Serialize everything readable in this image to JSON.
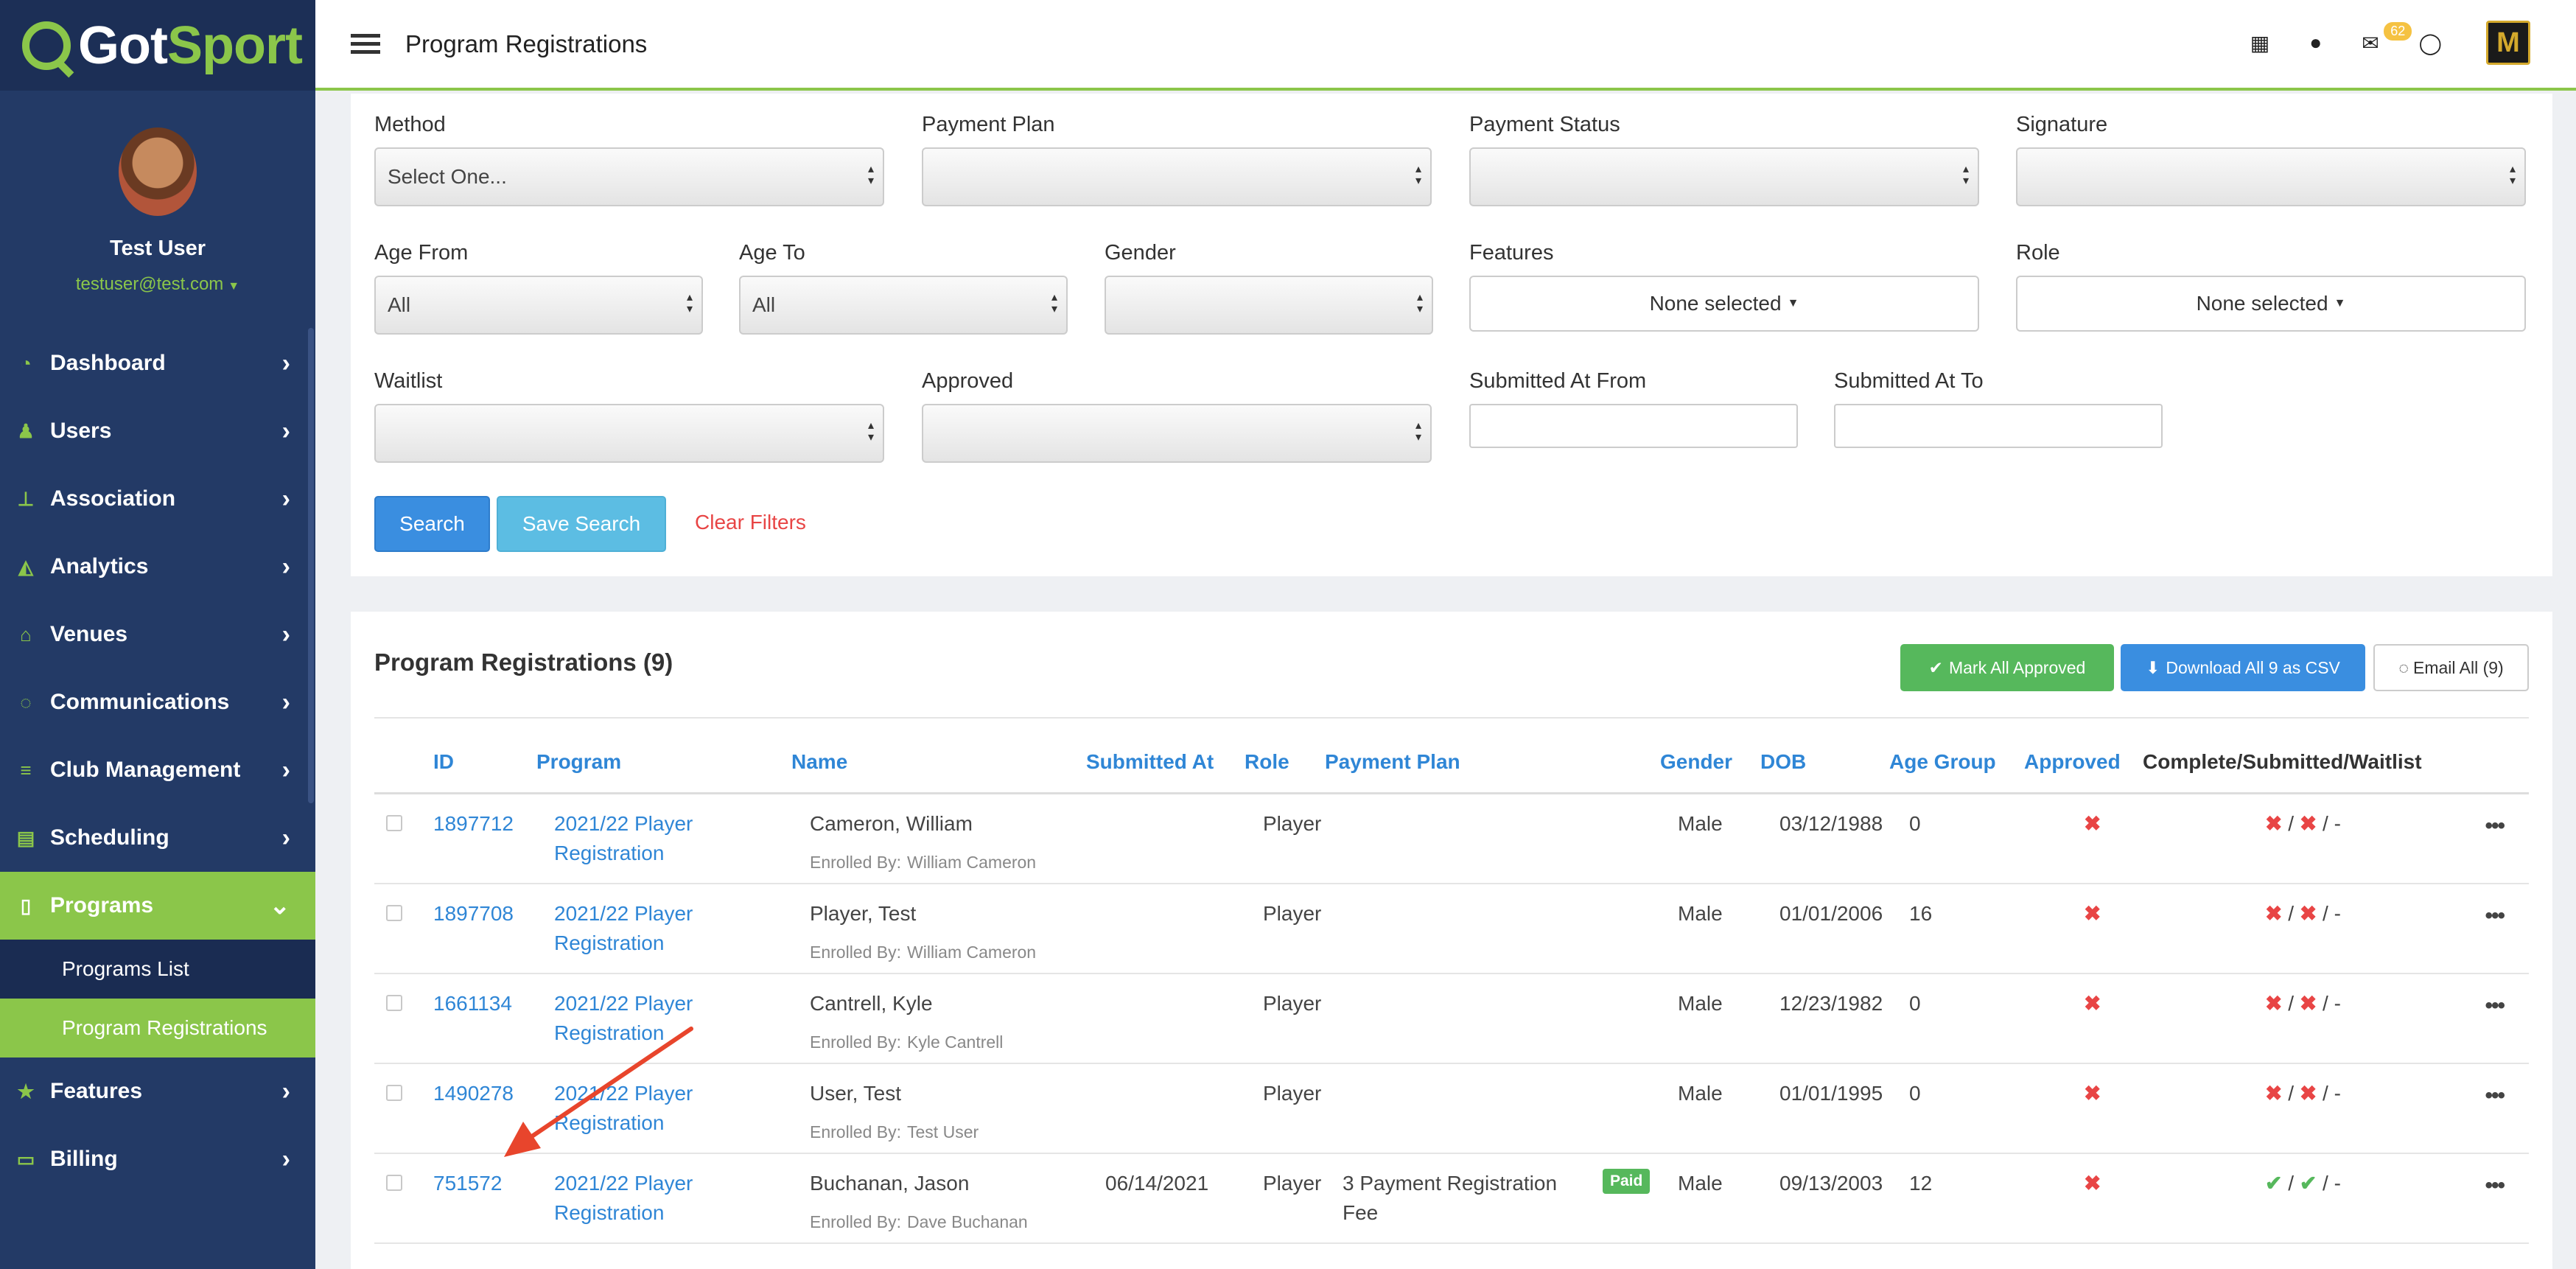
{
  "sidebar": {
    "brand_got": "Got",
    "brand_sport": "Sport",
    "user_name": "Test User",
    "user_email": "testuser@test.com",
    "items": [
      {
        "label": "Dashboard",
        "icon": "dashboard-icon"
      },
      {
        "label": "Users",
        "icon": "users-icon"
      },
      {
        "label": "Association",
        "icon": "sitemap-icon"
      },
      {
        "label": "Analytics",
        "icon": "chart-icon"
      },
      {
        "label": "Venues",
        "icon": "home-icon"
      },
      {
        "label": "Communications",
        "icon": "chat-icon"
      },
      {
        "label": "Club Management",
        "icon": "list-icon"
      },
      {
        "label": "Scheduling",
        "icon": "calendar-icon"
      },
      {
        "label": "Programs",
        "icon": "file-icon"
      },
      {
        "label": "Features",
        "icon": "star-icon"
      },
      {
        "label": "Billing",
        "icon": "credit-card-icon"
      }
    ],
    "sub_items": [
      "Programs List",
      "Program Registrations"
    ]
  },
  "header": {
    "title": "Program Registrations",
    "message_count": "62",
    "org_logo_letter": "M"
  },
  "filters": {
    "method_label": "Method",
    "method_value": "Select One...",
    "payment_plan_label": "Payment Plan",
    "payment_status_label": "Payment Status",
    "signature_label": "Signature",
    "age_from_label": "Age From",
    "age_from_value": "All",
    "age_to_label": "Age To",
    "age_to_value": "All",
    "gender_label": "Gender",
    "features_label": "Features",
    "features_value": "None selected",
    "role_label": "Role",
    "role_value": "None selected",
    "waitlist_label": "Waitlist",
    "approved_label": "Approved",
    "submitted_from_label": "Submitted At From",
    "submitted_to_label": "Submitted At To",
    "search_btn": "Search",
    "save_search_btn": "Save Search",
    "clear_filters": "Clear Filters"
  },
  "results": {
    "title": "Program Registrations (9)",
    "mark_all_approved": "Mark All Approved",
    "download_csv": "Download All 9 as CSV",
    "email_all": "Email All (9)",
    "columns": [
      "ID",
      "Program",
      "Name",
      "Submitted At",
      "Role",
      "Payment Plan",
      "Gender",
      "DOB",
      "Age Group",
      "Approved",
      "Complete/Submitted/Waitlist"
    ],
    "enrolled_prefix": "Enrolled By:",
    "rows": [
      {
        "id": "1897712",
        "program1": "2021/22 Player",
        "program2": "Registration",
        "name": "Cameron, William",
        "enrolled_by": "William Cameron",
        "submitted": "",
        "role": "Player",
        "plan1": "",
        "plan2": "",
        "status": "",
        "gender": "Male",
        "dob": "03/12/1988",
        "age_group": "0",
        "approved": "✖",
        "c1": "✖",
        "c2": "✖",
        "c3": "-"
      },
      {
        "id": "1897708",
        "program1": "2021/22 Player",
        "program2": "Registration",
        "name": "Player, Test",
        "enrolled_by": "William Cameron",
        "submitted": "",
        "role": "Player",
        "plan1": "",
        "plan2": "",
        "status": "",
        "gender": "Male",
        "dob": "01/01/2006",
        "age_group": "16",
        "approved": "✖",
        "c1": "✖",
        "c2": "✖",
        "c3": "-"
      },
      {
        "id": "1661134",
        "program1": "2021/22 Player",
        "program2": "Registration",
        "name": "Cantrell, Kyle",
        "enrolled_by": "Kyle Cantrell",
        "submitted": "",
        "role": "Player",
        "plan1": "",
        "plan2": "",
        "status": "",
        "gender": "Male",
        "dob": "12/23/1982",
        "age_group": "0",
        "approved": "✖",
        "c1": "✖",
        "c2": "✖",
        "c3": "-"
      },
      {
        "id": "1490278",
        "program1": "2021/22 Player",
        "program2": "Registration",
        "name": "User, Test",
        "enrolled_by": "Test User",
        "submitted": "",
        "role": "Player",
        "plan1": "",
        "plan2": "",
        "status": "",
        "gender": "Male",
        "dob": "01/01/1995",
        "age_group": "0",
        "approved": "✖",
        "c1": "✖",
        "c2": "✖",
        "c3": "-"
      },
      {
        "id": "751572",
        "program1": "2021/22 Player",
        "program2": "Registration",
        "name": "Buchanan, Jason",
        "enrolled_by": "Dave Buchanan",
        "submitted": "06/14/2021",
        "role": "Player",
        "plan1": "3 Payment Registration",
        "plan2": "Fee",
        "status": "Paid",
        "gender": "Male",
        "dob": "09/13/2003",
        "age_group": "12",
        "approved": "✖",
        "c1": "✔",
        "c2": "✔",
        "c3": "-"
      }
    ]
  },
  "colors": {
    "brand_green": "#8bc64a",
    "sidebar_navy": "#233a66",
    "link_blue": "#2f86d6",
    "danger_red": "#e84545"
  }
}
